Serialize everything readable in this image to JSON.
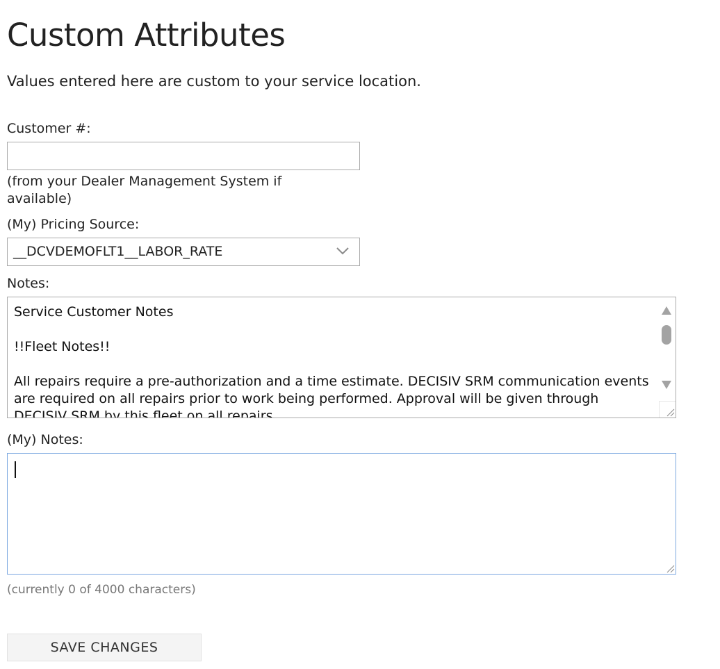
{
  "page": {
    "title": "Custom Attributes",
    "intro": "Values entered here are custom to your service location."
  },
  "customer": {
    "label": "Customer #:",
    "value": "",
    "placeholder": "",
    "hint": "(from your Dealer Management System if available)"
  },
  "pricing": {
    "label": "(My) Pricing Source:",
    "selected": "__DCVDEMOFLT1__LABOR_RATE"
  },
  "notes": {
    "label": "Notes:",
    "content": "Service Customer Notes\n\n!!Fleet Notes!!\n\nAll repairs require a pre-authorization and a time estimate. DECISIV SRM communication events are required on all repairs prior to work being performed. Approval will be given through DECISIV SRM by this fleet on all repairs."
  },
  "my_notes": {
    "label": "(My) Notes:",
    "value": "",
    "counter": "(currently 0 of 4000 characters)"
  },
  "actions": {
    "save_label": "SAVE CHANGES"
  },
  "colors": {
    "text": "#222222",
    "border": "#a9a9a9",
    "focus_border": "#7aa7e0",
    "muted": "#777777",
    "button_bg": "#f4f4f4"
  },
  "icons": {
    "select_arrow": "chevron-down-icon",
    "scroll_up": "triangle-up-icon",
    "scroll_down": "triangle-down-icon",
    "resize": "resize-grip-icon"
  }
}
